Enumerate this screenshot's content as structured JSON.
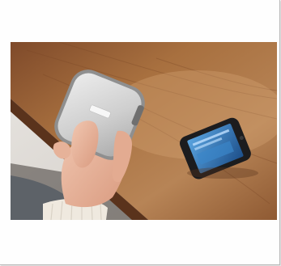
{
  "page": {
    "background": "#ffffff",
    "card_color": "#fefefe",
    "border_color": "#b8b8b8"
  },
  "photo": {
    "subject": "product-photo",
    "palette": {
      "wall": "#e6e3df",
      "table": "#a0643a",
      "table_dark": "#6e3f22",
      "speaker": "#d6d6d6",
      "speaker_rim": "#9a9a9a",
      "phone": "#1c1c1e",
      "screen": "#2a6fb0",
      "skin": "#e8b79f",
      "sleeve": "#efe9df",
      "trousers": "#5d6268"
    }
  }
}
